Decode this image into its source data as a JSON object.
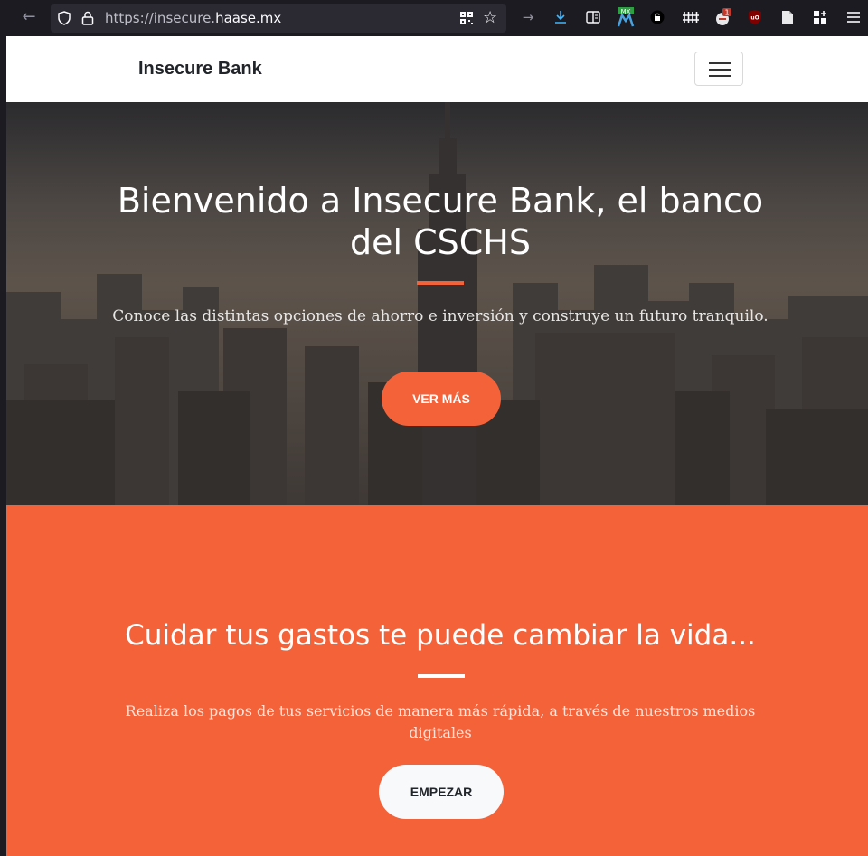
{
  "browser": {
    "url_prefix": "https://insecure.",
    "url_domain": "haase.mx",
    "icons": [
      "back-arrow-icon",
      "shield-icon",
      "lock-icon",
      "qr-code-icon",
      "bookmark-star-icon",
      "forward-icon",
      "download-icon",
      "reader-view-icon",
      "mx-extension-icon",
      "extension-icon",
      "fence-icon",
      "extension-badge-icon",
      "ublock-icon",
      "page-icon",
      "extensions-icon",
      "menu-icon"
    ]
  },
  "navbar": {
    "brand": "Insecure Bank"
  },
  "hero": {
    "title": "Bienvenido a Insecure Bank, el banco del CSCHS",
    "subtitle": "Conoce las distintas opciones de ahorro e inversión y construye un futuro tranquilo.",
    "button": "VER MÁS"
  },
  "section": {
    "title": "Cuidar tus gastos te puede cambiar la vida...",
    "text": "Realiza los pagos de tus servicios de manera más rápida, a través de nuestros medios digitales",
    "button": "EMPEZAR"
  },
  "colors": {
    "accent": "#f4623a",
    "light": "#f8f9fa",
    "dark": "#212529"
  }
}
